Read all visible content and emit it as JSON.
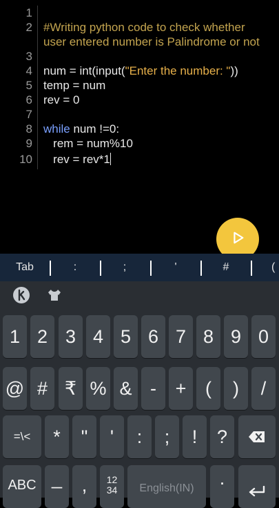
{
  "editor": {
    "line_numbers": [
      "1",
      "2",
      "",
      "3",
      "4",
      "5",
      "6",
      "7",
      "8",
      "9",
      "10"
    ],
    "lines": {
      "l2a": "#Writing python code to check whether",
      "l2b": "user entered number is Palindrome or not",
      "l4_pre": "num = int(input(",
      "l4_str": "\"Enter the number: \"",
      "l4_post": "))",
      "l5": "temp = num",
      "l6": "rev = 0",
      "l8_kw": "while",
      "l8_rest": " num !=0:",
      "l9": "   rem = num%10",
      "l10": "   rev = rev*1"
    }
  },
  "run_button": {
    "icon": "play-icon"
  },
  "symbol_bar": {
    "items": [
      "Tab",
      ":",
      ";",
      "'",
      "#",
      "("
    ]
  },
  "keyboard": {
    "top_icons": [
      "kika-logo-icon",
      "shirt-icon"
    ],
    "row_numbers": [
      "1",
      "2",
      "3",
      "4",
      "5",
      "6",
      "7",
      "8",
      "9",
      "0"
    ],
    "row_symbols1": [
      "@",
      "#",
      "₹",
      "%",
      "&",
      "-",
      "+",
      "(",
      ")",
      "/"
    ],
    "row_symbols2": [
      "=\\<",
      "*",
      "\"",
      "'",
      ":",
      ";",
      "!",
      "?"
    ],
    "backspace_icon": "backspace-icon",
    "row_bottom": {
      "abc": "ABC",
      "underscore": "_",
      "comma": ",",
      "num_top": "12",
      "num_bottom": "34",
      "space": "English(IN)",
      "period": ".",
      "enter_icon": "enter-icon"
    }
  },
  "colors": {
    "accent": "#f3c63d",
    "symbol_bar": "#17263a",
    "keyboard_bg": "#2a2e33",
    "key_bg": "#41474d"
  }
}
